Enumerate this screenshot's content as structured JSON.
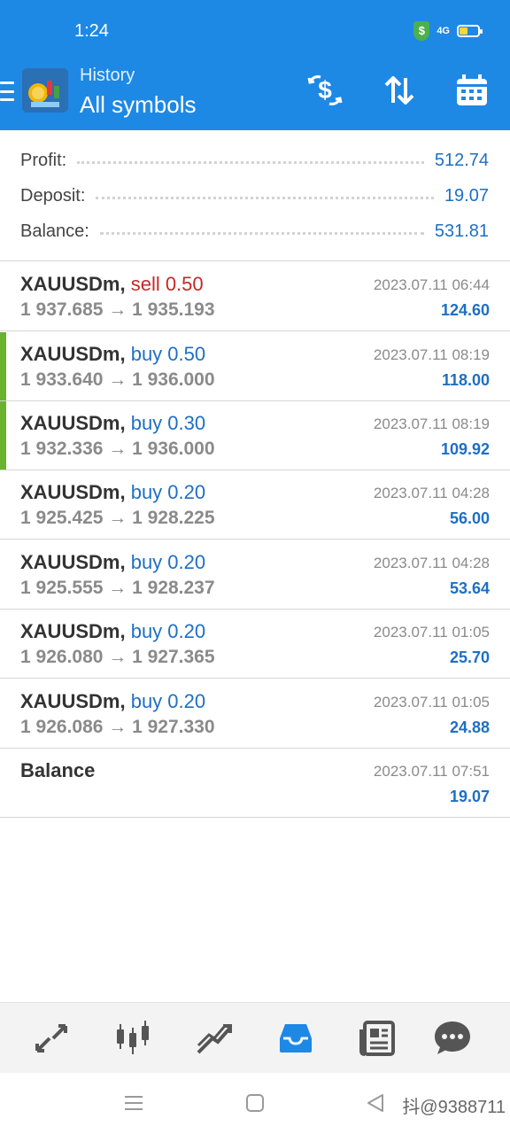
{
  "status_bar": {
    "time": "1:24",
    "network": "4G"
  },
  "header": {
    "subtitle": "History",
    "title": "All symbols"
  },
  "toolbar_icons": [
    "currency-exchange-icon",
    "sort-icon",
    "calendar-icon"
  ],
  "summary": [
    {
      "label": "Profit:",
      "value": "512.74"
    },
    {
      "label": "Deposit:",
      "value": "19.07"
    },
    {
      "label": "Balance:",
      "value": "531.81"
    }
  ],
  "deals": [
    {
      "symbol": "XAUUSDm,",
      "side": "sell 0.50",
      "type": "sell",
      "prices": "1 937.685 → 1 935.193",
      "time": "2023.07.11 06:44",
      "profit": "124.60",
      "marked": false
    },
    {
      "symbol": "XAUUSDm,",
      "side": "buy 0.50",
      "type": "buy",
      "prices": "1 933.640 → 1 936.000",
      "time": "2023.07.11 08:19",
      "profit": "118.00",
      "marked": true
    },
    {
      "symbol": "XAUUSDm,",
      "side": "buy 0.30",
      "type": "buy",
      "prices": "1 932.336 → 1 936.000",
      "time": "2023.07.11 08:19",
      "profit": "109.92",
      "marked": true
    },
    {
      "symbol": "XAUUSDm,",
      "side": "buy 0.20",
      "type": "buy",
      "prices": "1 925.425 → 1 928.225",
      "time": "2023.07.11 04:28",
      "profit": "56.00",
      "marked": false
    },
    {
      "symbol": "XAUUSDm,",
      "side": "buy 0.20",
      "type": "buy",
      "prices": "1 925.555 → 1 928.237",
      "time": "2023.07.11 04:28",
      "profit": "53.64",
      "marked": false
    },
    {
      "symbol": "XAUUSDm,",
      "side": "buy 0.20",
      "type": "buy",
      "prices": "1 926.080 → 1 927.365",
      "time": "2023.07.11 01:05",
      "profit": "25.70",
      "marked": false
    },
    {
      "symbol": "XAUUSDm,",
      "side": "buy 0.20",
      "type": "buy",
      "prices": "1 926.086 → 1 927.330",
      "time": "2023.07.11 01:05",
      "profit": "24.88",
      "marked": false
    },
    {
      "symbol": "Balance",
      "side": "",
      "type": "balance",
      "prices": "",
      "time": "2023.07.11 07:51",
      "profit": "19.07",
      "marked": false
    }
  ],
  "bottom_nav": [
    "quotes-icon",
    "chart-icon",
    "trade-icon",
    "history-icon",
    "news-icon",
    "messages-icon"
  ],
  "bottom_nav_active": "history-icon",
  "watermark": "抖@9388711",
  "colors": {
    "header_bg": "#1e88e5",
    "buy": "#1e6fc4",
    "sell": "#c62828",
    "profit": "#1e6fc4",
    "marker": "#6bb22e",
    "active_nav": "#1e88e5",
    "inactive_nav": "#555555"
  }
}
